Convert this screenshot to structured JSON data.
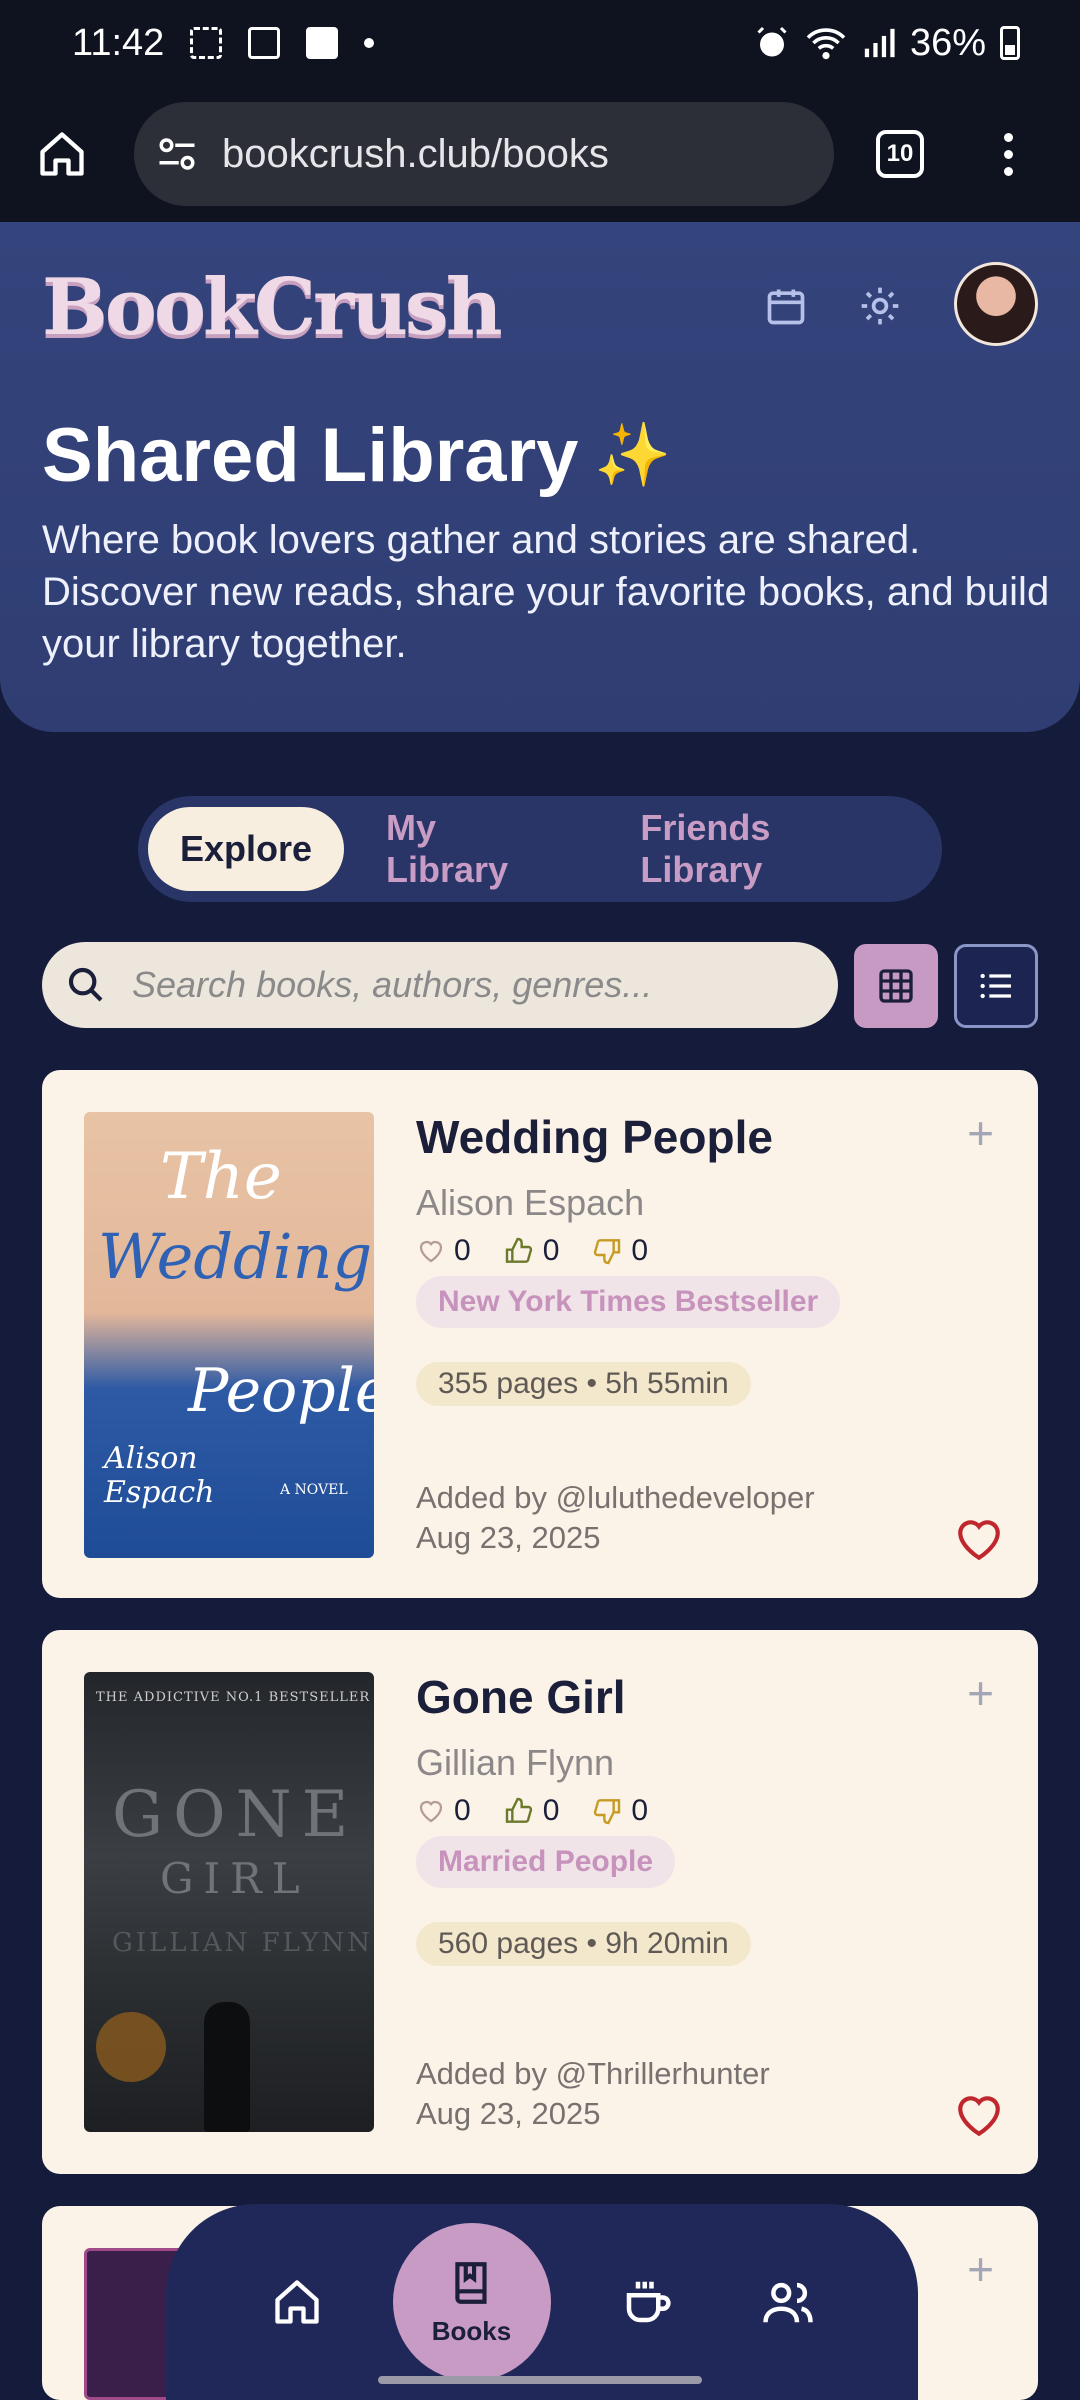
{
  "status_bar": {
    "time": "11:42",
    "battery": "36%"
  },
  "browser": {
    "url": "bookcrush.club/books",
    "tab_count": "10"
  },
  "header": {
    "logo": "BookCrush"
  },
  "hero": {
    "title": "Shared Library",
    "emoji": "✨",
    "subtitle": "Where book lovers gather and stories are shared. Discover new reads, share your favorite books, and build your library together."
  },
  "tabs": [
    {
      "label": "Explore",
      "active": true
    },
    {
      "label": "My Library",
      "active": false
    },
    {
      "label": "Friends Library",
      "active": false
    }
  ],
  "search": {
    "placeholder": "Search books, authors, genres..."
  },
  "books": [
    {
      "title": "Wedding People",
      "author": "Alison Espach",
      "likes": "0",
      "thumbs_up": "0",
      "thumbs_down": "0",
      "tag": "New York Times Bestseller",
      "pages": "355 pages • 5h 55min",
      "added_by": "Added by @luluthedeveloper",
      "date": "Aug 23, 2025",
      "cover": {
        "line1": "The",
        "line2": "Wedding",
        "line3": "People",
        "author": "Alison Espach",
        "note": "A NOVEL"
      }
    },
    {
      "title": "Gone Girl",
      "author": "Gillian Flynn",
      "likes": "0",
      "thumbs_up": "0",
      "thumbs_down": "0",
      "tag": "Married People",
      "pages": "560 pages • 9h 20min",
      "added_by": "Added by @Thrillerhunter",
      "date": "Aug 23, 2025",
      "cover": {
        "top": "THE ADDICTIVE NO.1 BESTSELLER",
        "line1": "GONE",
        "line2": "GIRL",
        "author": "GILLIAN FLYNN"
      }
    }
  ],
  "bottom_nav": {
    "active_label": "Books"
  },
  "colors": {
    "accent": "#c89bc4",
    "hero": "#34447c",
    "background": "#151b3b",
    "card": "#fbf3e8",
    "heart": "#c0272d"
  }
}
